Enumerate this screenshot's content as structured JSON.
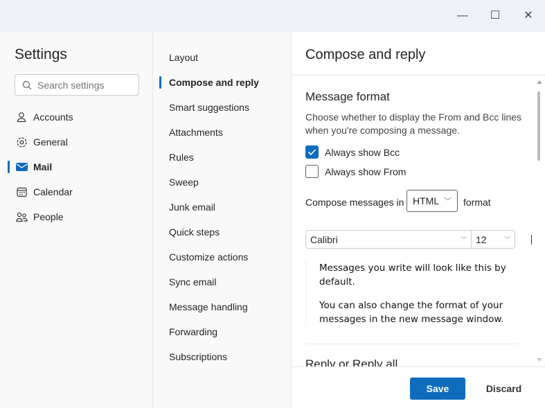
{
  "window": {
    "minimize": "—",
    "maximize": "☐",
    "close": "✕"
  },
  "sidebar": {
    "title": "Settings",
    "search_placeholder": "Search settings",
    "items": [
      {
        "label": "Accounts",
        "icon": "person-icon"
      },
      {
        "label": "General",
        "icon": "gear-icon"
      },
      {
        "label": "Mail",
        "icon": "mail-icon",
        "active": true
      },
      {
        "label": "Calendar",
        "icon": "calendar-icon"
      },
      {
        "label": "People",
        "icon": "people-icon"
      }
    ]
  },
  "subnav": {
    "items": [
      "Layout",
      "Compose and reply",
      "Smart suggestions",
      "Attachments",
      "Rules",
      "Sweep",
      "Junk email",
      "Quick steps",
      "Customize actions",
      "Sync email",
      "Message handling",
      "Forwarding",
      "Subscriptions"
    ],
    "active": "Compose and reply"
  },
  "main": {
    "title": "Compose and reply",
    "section": "Message format",
    "description": "Choose whether to display the From and Bcc lines when you're composing a message.",
    "always_bcc": {
      "label": "Always show Bcc",
      "checked": true
    },
    "always_from": {
      "label": "Always show From",
      "checked": false
    },
    "compose_prefix": "Compose messages in",
    "compose_format": "HTML",
    "compose_suffix": "format",
    "font": "Calibri",
    "font_size": "12",
    "preview1": "Messages you write will look like this by default.",
    "preview2": "You can also change the format of your messages in the new message window.",
    "next_section": "Reply or Reply all"
  },
  "footer": {
    "save": "Save",
    "discard": "Discard"
  },
  "colors": {
    "accent": "#0f6cbd"
  }
}
